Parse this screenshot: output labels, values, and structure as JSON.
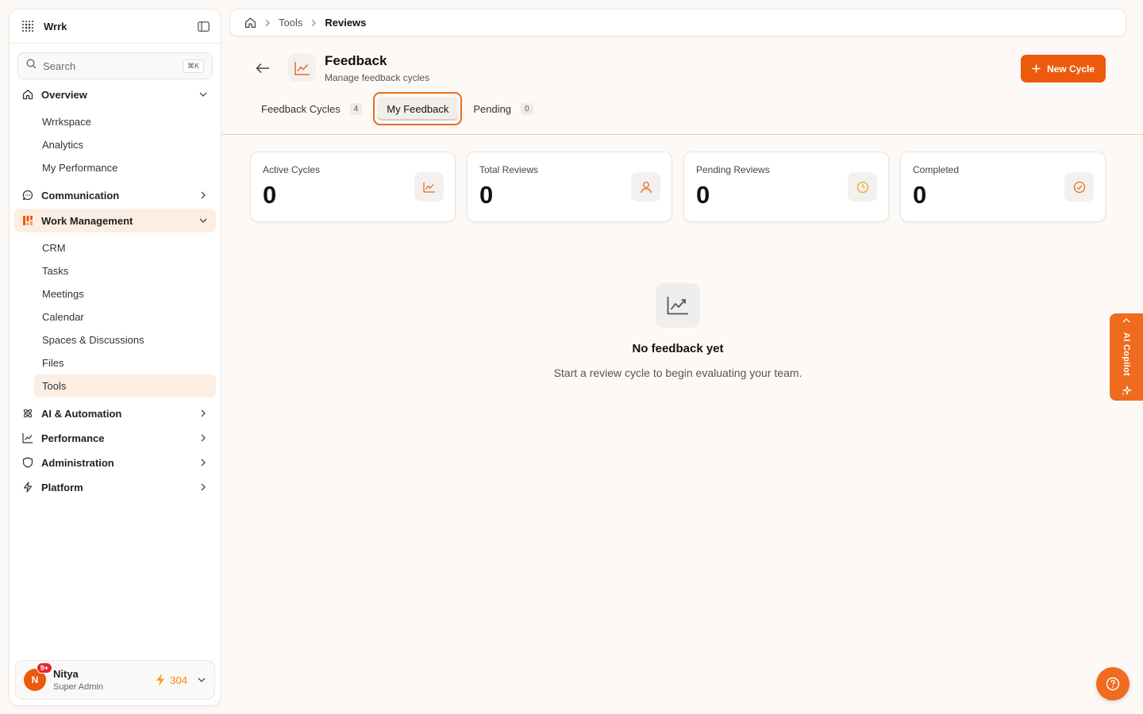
{
  "sidebar": {
    "brand": "Wrrk",
    "search": {
      "label": "Search",
      "shortcut": "⌘K"
    },
    "groups": [
      {
        "label": "Overview",
        "icon": "home-icon",
        "expanded": true,
        "items": [
          "Wrrkspace",
          "Analytics",
          "My Performance"
        ]
      },
      {
        "label": "Communication",
        "icon": "chat-icon",
        "expanded": false,
        "items": []
      },
      {
        "label": "Work Management",
        "icon": "grid-icon",
        "expanded": true,
        "active": true,
        "items": [
          "CRM",
          "Tasks",
          "Meetings",
          "Calendar",
          "Spaces & Discussions",
          "Files",
          "Tools"
        ],
        "active_item": "Tools"
      },
      {
        "label": "AI & Automation",
        "icon": "atom-icon",
        "expanded": false,
        "items": []
      },
      {
        "label": "Performance",
        "icon": "trend-icon",
        "expanded": false,
        "items": []
      },
      {
        "label": "Administration",
        "icon": "shield-icon",
        "expanded": false,
        "items": []
      },
      {
        "label": "Platform",
        "icon": "bolt-icon",
        "expanded": false,
        "items": []
      }
    ],
    "user": {
      "initial": "N",
      "name": "Nitya",
      "role": "Super Admin",
      "notifications": "9+",
      "points": "304"
    }
  },
  "breadcrumb": {
    "items": [
      "Tools",
      "Reviews"
    ]
  },
  "header": {
    "title": "Feedback",
    "subtitle": "Manage feedback cycles",
    "new_button": "New Cycle"
  },
  "tabs": [
    {
      "label": "Feedback Cycles",
      "count": "4"
    },
    {
      "label": "My Feedback",
      "active": true
    },
    {
      "label": "Pending",
      "count": "0"
    }
  ],
  "stats": [
    {
      "label": "Active Cycles",
      "value": "0",
      "icon": "trend-icon"
    },
    {
      "label": "Total Reviews",
      "value": "0",
      "icon": "user-icon"
    },
    {
      "label": "Pending Reviews",
      "value": "0",
      "icon": "clock-icon"
    },
    {
      "label": "Completed",
      "value": "0",
      "icon": "check-circle-icon"
    }
  ],
  "empty_state": {
    "title": "No feedback yet",
    "description": "Start a review cycle to begin evaluating your team."
  },
  "copilot": {
    "label": "AI Copilot"
  },
  "colors": {
    "accent": "#ec5a0c",
    "active_bg": "#fdeee3"
  }
}
